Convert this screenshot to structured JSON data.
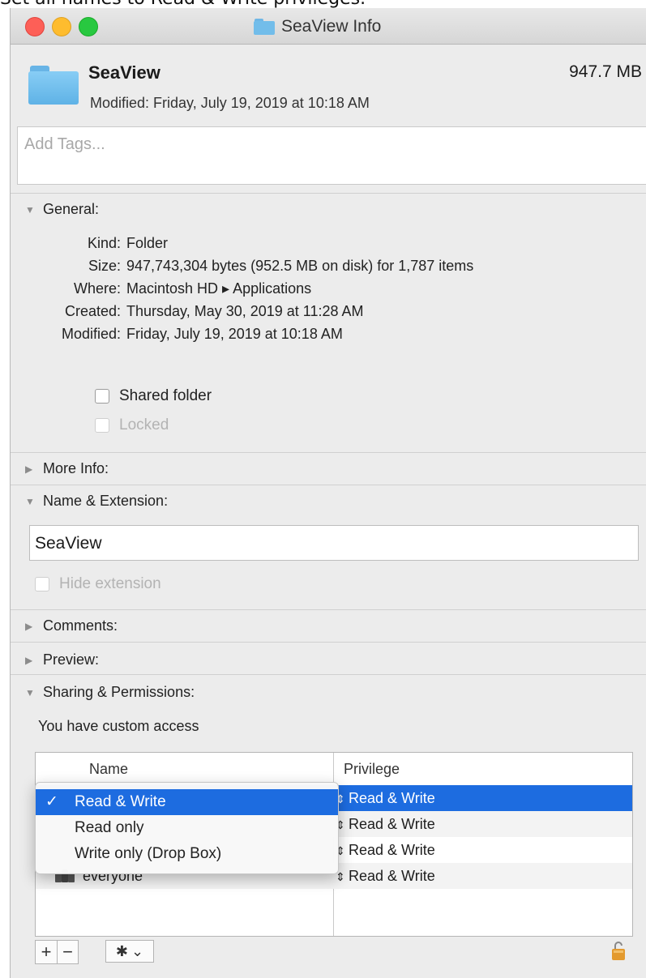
{
  "instruction": "Set all names to Read & Write privileges.",
  "window": {
    "title": "SeaView Info"
  },
  "header": {
    "name": "SeaView",
    "size": "947.7 MB",
    "modified": "Modified: Friday, July 19, 2019 at 10:18 AM"
  },
  "tags": {
    "placeholder": "Add Tags..."
  },
  "general": {
    "heading": "General:",
    "kind_label": "Kind:",
    "kind_value": "Folder",
    "size_label": "Size:",
    "size_value": "947,743,304 bytes (952.5 MB on disk) for 1,787 items",
    "where_label": "Where:",
    "where_value": "Macintosh HD ▸ Applications",
    "created_label": "Created:",
    "created_value": "Thursday, May 30, 2019 at 11:28 AM",
    "modified_label": "Modified:",
    "modified_value": "Friday, July 19, 2019 at 10:18 AM",
    "shared_folder": "Shared folder",
    "locked": "Locked"
  },
  "more_info": {
    "heading": "More Info:"
  },
  "name_extension": {
    "heading": "Name & Extension:",
    "name_value": "SeaView",
    "hide_extension": "Hide extension"
  },
  "comments": {
    "heading": "Comments:"
  },
  "preview": {
    "heading": "Preview:"
  },
  "sharing": {
    "heading": "Sharing & Permissions:",
    "access_text": "You have custom access",
    "columns": {
      "name": "Name",
      "privilege": "Privilege"
    },
    "rows": [
      {
        "name": "",
        "privilege": "Read & Write",
        "selected": true
      },
      {
        "name": "",
        "privilege": "Read & Write"
      },
      {
        "name": "",
        "privilege": "Read & Write"
      },
      {
        "name": "everyone",
        "privilege": "Read & Write"
      }
    ],
    "menu": {
      "check": "✓",
      "items": [
        "Read & Write",
        "Read only",
        "Write only (Drop Box)"
      ]
    },
    "add_label": "+",
    "remove_label": "−",
    "gear_label": "✱",
    "gear_arrow": "⌄"
  },
  "colors": {
    "selection": "#1d6ce0",
    "folder": "#6fb7e6"
  },
  "icons": [
    "close-icon",
    "minimize-icon",
    "zoom-icon",
    "folder-icon",
    "disclosure-triangle-icon",
    "group-icon",
    "gear-icon",
    "lock-icon"
  ]
}
